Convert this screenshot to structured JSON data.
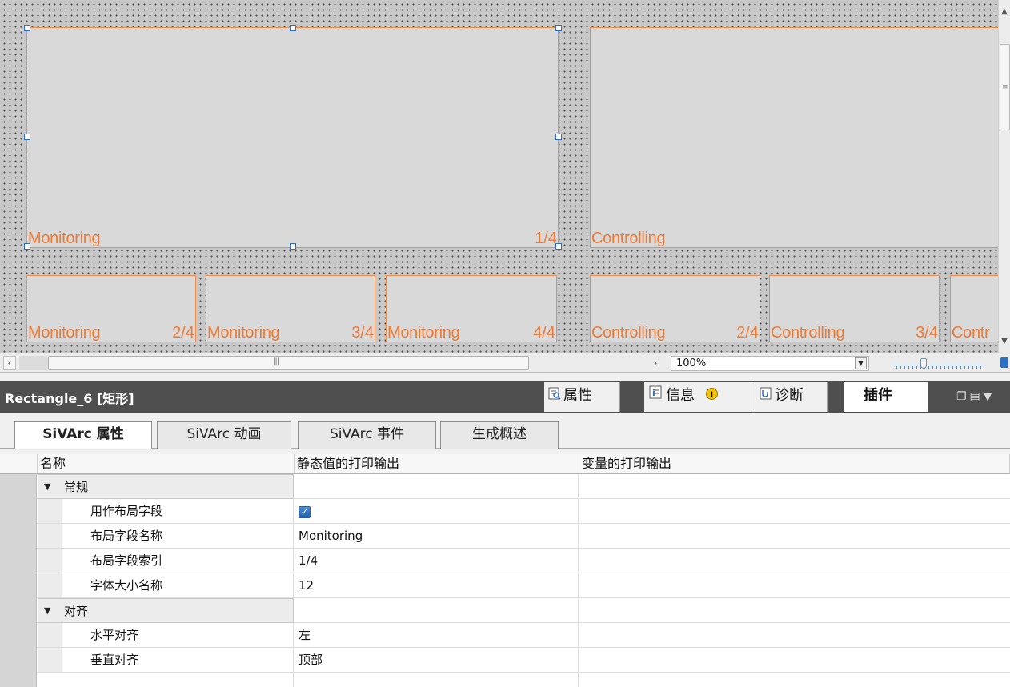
{
  "canvas": {
    "fields": [
      {
        "name": "Monitoring",
        "index": "1/4"
      },
      {
        "name": "Controlling",
        "index": ""
      },
      {
        "name": "Monitoring",
        "index": "2/4"
      },
      {
        "name": "Monitoring",
        "index": "3/4"
      },
      {
        "name": "Monitoring",
        "index": "4/4"
      },
      {
        "name": "Controlling",
        "index": "2/4"
      },
      {
        "name": "Controlling",
        "index": "3/4"
      },
      {
        "name": "Contr",
        "index": ""
      }
    ]
  },
  "zoom": {
    "value": "100%"
  },
  "inspector": {
    "title": "Rectangle_6 [矩形]",
    "tabs": {
      "properties": "属性",
      "info": "信息",
      "diagnostics": "诊断",
      "plugins": "插件"
    }
  },
  "subtabs": [
    "SiVArc 属性",
    "SiVArc 动画",
    "SiVArc 事件",
    "生成概述"
  ],
  "grid": {
    "columns": [
      "名称",
      "静态值的打印输出",
      "变量的打印输出"
    ],
    "rows": [
      {
        "type": "group",
        "label": "常规",
        "value": ""
      },
      {
        "type": "child",
        "label": "用作布局字段",
        "value": "",
        "checked": true
      },
      {
        "type": "child",
        "label": "布局字段名称",
        "value": "Monitoring"
      },
      {
        "type": "child",
        "label": "布局字段索引",
        "value": "1/4"
      },
      {
        "type": "child",
        "label": "字体大小名称",
        "value": "12"
      },
      {
        "type": "group",
        "label": "对齐",
        "value": ""
      },
      {
        "type": "child",
        "label": "水平对齐",
        "value": "左"
      },
      {
        "type": "child",
        "label": "垂直对齐",
        "value": "顶部"
      }
    ]
  }
}
